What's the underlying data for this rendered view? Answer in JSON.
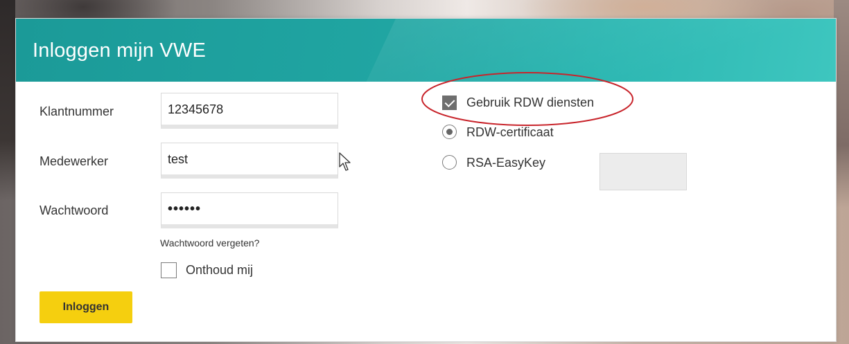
{
  "card": {
    "title": "Inloggen mijn VWE"
  },
  "form": {
    "klantnummer": {
      "label": "Klantnummer",
      "value": "12345678"
    },
    "medewerker": {
      "label": "Medewerker",
      "value": "test"
    },
    "wachtwoord": {
      "label": "Wachtwoord",
      "value": "••••••"
    },
    "forgot_link": "Wachtwoord vergeten?",
    "remember": {
      "label": "Onthoud mij",
      "checked": false
    },
    "login_button": "Inloggen"
  },
  "rdw": {
    "use_rdw": {
      "label": "Gebruik RDW diensten",
      "checked": true
    },
    "options": [
      {
        "label": "RDW-certificaat",
        "selected": true
      },
      {
        "label": "RSA-EasyKey",
        "selected": false
      }
    ],
    "easykey_value": ""
  },
  "colors": {
    "header_teal": "#20a5a2",
    "button_yellow": "#f5cf0f",
    "highlight_red": "#c8242b"
  },
  "icons": [
    "check-icon",
    "mouse-cursor-icon"
  ]
}
